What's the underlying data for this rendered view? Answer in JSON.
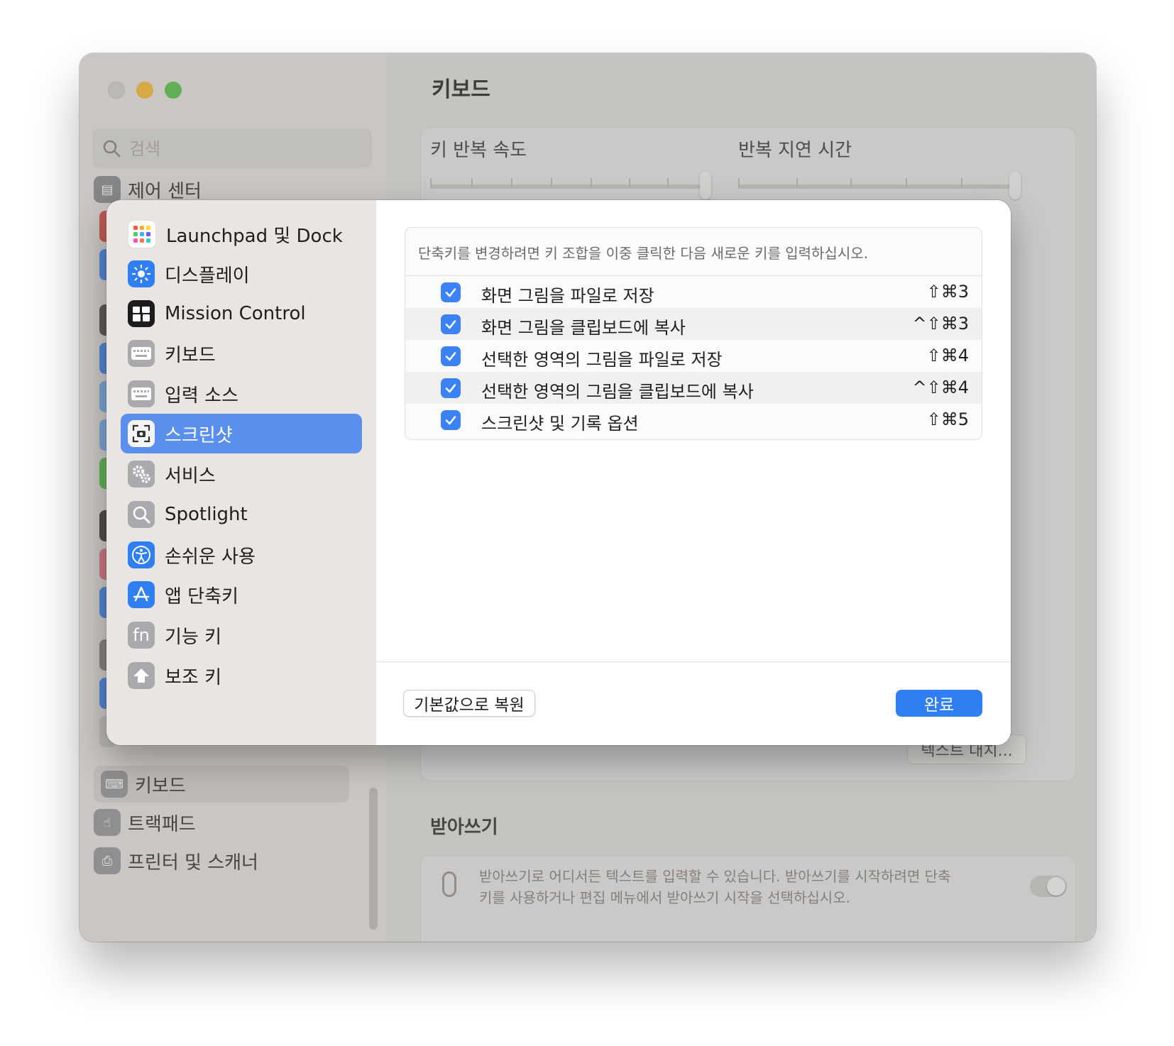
{
  "window": {
    "search_placeholder": "검색",
    "main_title": "키보드",
    "sidebar_peek": [
      {
        "label": "제어 센터",
        "icon": "control-center-icon"
      },
      {
        "label": "키보드",
        "icon": "keyboard-icon"
      },
      {
        "label": "트랙패드",
        "icon": "trackpad-icon"
      },
      {
        "label": "프린터 및 스캐너",
        "icon": "printer-icon"
      }
    ],
    "key_repeat_label": "키 반복 속도",
    "repeat_delay_label": "반복 지연 시간",
    "text_replacement_button": "텍스트 대치...",
    "dictation_title": "받아쓰기",
    "dictation_description": "받아쓰기로 어디서든 텍스트를 입력할 수 있습니다. 받아쓰기를 시작하려면 단축키를 사용하거나 편집 메뉴에서 받아쓰기 시작을 선택하십시오."
  },
  "sheet": {
    "categories": [
      {
        "label": "Launchpad 및 Dock",
        "icon": "launchpad-icon"
      },
      {
        "label": "디스플레이",
        "icon": "display-brightness-icon"
      },
      {
        "label": "Mission Control",
        "icon": "mission-control-icon"
      },
      {
        "label": "키보드",
        "icon": "keyboard-icon"
      },
      {
        "label": "입력 소스",
        "icon": "input-sources-icon"
      },
      {
        "label": "스크린샷",
        "icon": "screenshot-icon"
      },
      {
        "label": "서비스",
        "icon": "gears-icon"
      },
      {
        "label": "Spotlight",
        "icon": "magnifier-icon"
      },
      {
        "label": "손쉬운 사용",
        "icon": "accessibility-icon"
      },
      {
        "label": "앱 단축키",
        "icon": "app-store-icon"
      },
      {
        "label": "기능 키",
        "icon": "fn-icon"
      },
      {
        "label": "보조 키",
        "icon": "modifier-keys-icon"
      }
    ],
    "selected_category": "스크린샷",
    "hint": "단축키를 변경하려면 키 조합을 이중 클릭한 다음 새로운 키를 입력하십시오.",
    "shortcuts": [
      {
        "label": "화면 그림을 파일로 저장",
        "keys": "⇧⌘3",
        "checked": true
      },
      {
        "label": "화면 그림을 클립보드에 복사",
        "keys": "^⇧⌘3",
        "checked": true
      },
      {
        "label": "선택한 영역의 그림을 파일로 저장",
        "keys": "⇧⌘4",
        "checked": true
      },
      {
        "label": "선택한 영역의 그림을 클립보드에 복사",
        "keys": "^⇧⌘4",
        "checked": true
      },
      {
        "label": "스크린샷 및 기록 옵션",
        "keys": "⇧⌘5",
        "checked": true
      }
    ],
    "restore_button": "기본값으로 복원",
    "done_button": "완료"
  },
  "colors": {
    "accent": "#2f7ff3",
    "selection": "#5a8fee",
    "traffic_min": "#f6bd3a",
    "traffic_max": "#5ec553"
  }
}
